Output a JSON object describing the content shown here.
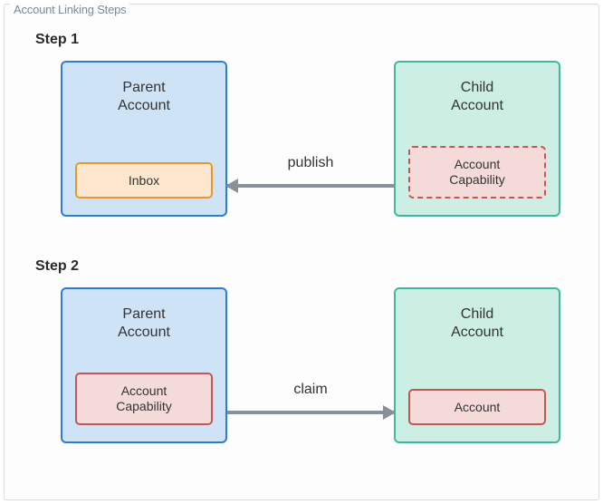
{
  "panel": {
    "title": "Account Linking Steps"
  },
  "steps": {
    "step1": {
      "label": "Step 1",
      "parent": {
        "title": "Parent\nAccount",
        "inner": "Inbox"
      },
      "child": {
        "title": "Child\nAccount",
        "inner": "Account\nCapability"
      },
      "arrow": {
        "label": "publish",
        "direction": "left"
      }
    },
    "step2": {
      "label": "Step 2",
      "parent": {
        "title": "Parent\nAccount",
        "inner": "Account\nCapability"
      },
      "child": {
        "title": "Child\nAccount",
        "inner": "Account"
      },
      "arrow": {
        "label": "claim",
        "direction": "right"
      }
    }
  }
}
